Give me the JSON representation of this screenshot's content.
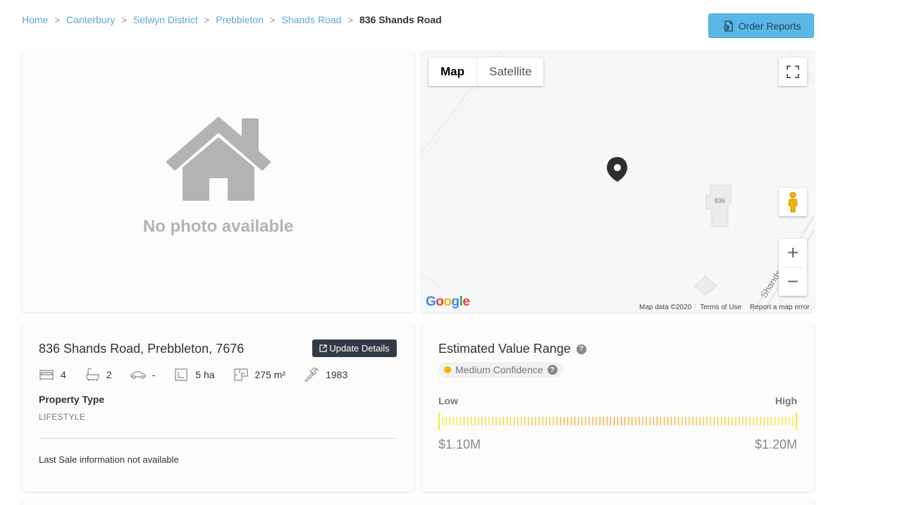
{
  "breadcrumb": {
    "items": [
      "Home",
      "Canterbury",
      "Selwyn District",
      "Prebbleton",
      "Shands Road"
    ],
    "current": "836 Shands Road",
    "separator": ">"
  },
  "order_reports": {
    "label": "Order Reports"
  },
  "photo": {
    "placeholder_text": "No photo available"
  },
  "map": {
    "type_map": "Map",
    "type_satellite": "Satellite",
    "zoom_in": "+",
    "zoom_out": "−",
    "parcel_number": "836",
    "road_label": "Shands R",
    "footer": {
      "map_data": "Map data ©2020",
      "terms": "Terms of Use",
      "report": "Report a map error"
    },
    "google_logo_letters": [
      "G",
      "o",
      "o",
      "g",
      "l",
      "e"
    ],
    "google_colors": [
      "#4285F4",
      "#EA4335",
      "#FBBC05",
      "#4285F4",
      "#34A853",
      "#EA4335"
    ]
  },
  "property": {
    "address": "836 Shands Road, Prebbleton, 7676",
    "update_label": "Update Details",
    "bedrooms": "4",
    "bathrooms": "2",
    "car_spaces": "-",
    "land_area": "5 ha",
    "floor_area": "275 m²",
    "year_built": "1983",
    "type_label": "Property Type",
    "type_value": "LIFESTYLE",
    "last_sale": "Last Sale information not available"
  },
  "estimate": {
    "title": "Estimated Value Range",
    "confidence": "Medium Confidence",
    "confidence_color": "#f5b400",
    "low_label": "Low",
    "high_label": "High",
    "low_value": "$1.10M",
    "high_value": "$1.20M",
    "tick_count": 100
  },
  "colors": {
    "accent": "#5bb8e6",
    "link": "#5aa8d6",
    "dark_button": "#323a45"
  }
}
